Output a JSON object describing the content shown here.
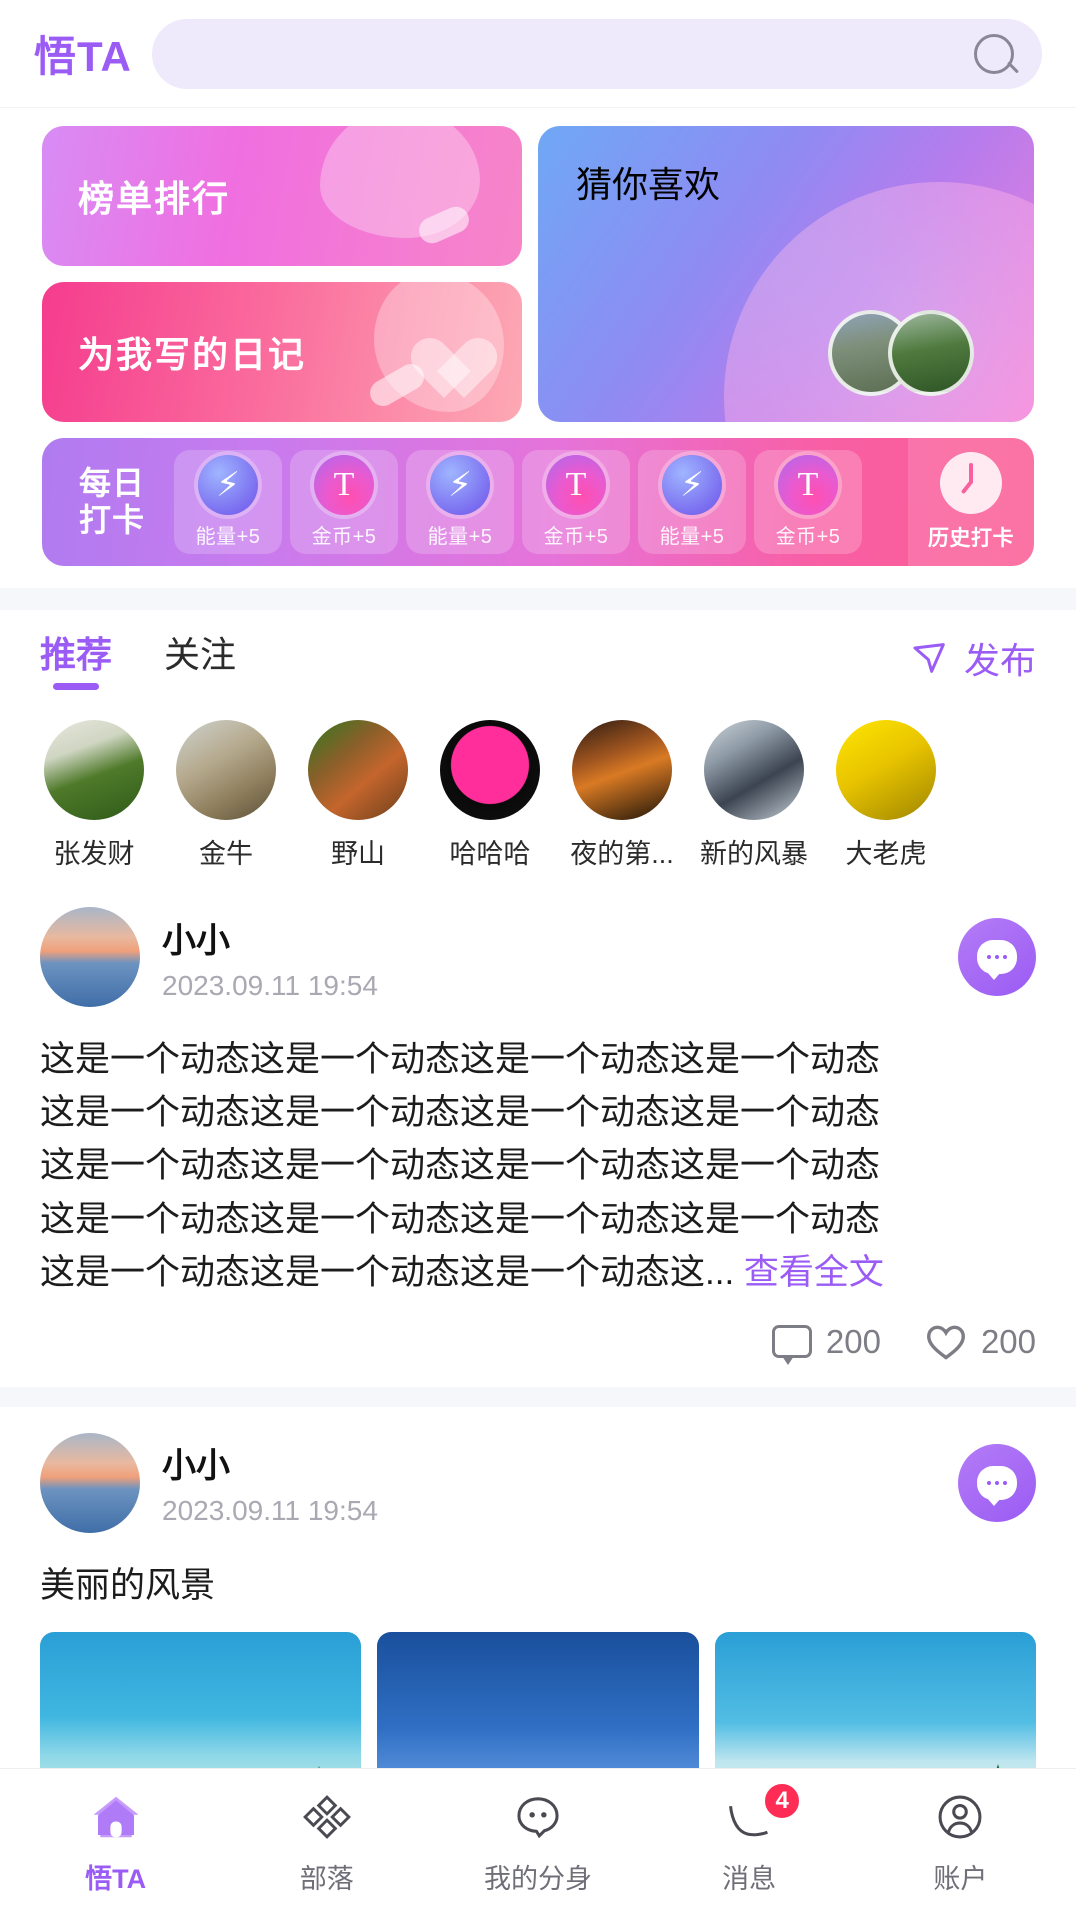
{
  "header": {
    "logo": "悟TA",
    "search_placeholder": "",
    "search_value": "",
    "search_icon": "search-icon"
  },
  "banners": {
    "rank": {
      "title": "榜单排行"
    },
    "diary": {
      "title": "为我写的日记"
    },
    "guess": {
      "title": "猜你喜欢"
    }
  },
  "checkin": {
    "label_line1": "每日",
    "label_line2": "打卡",
    "items": [
      {
        "icon": "energy-icon",
        "label": "能量+5"
      },
      {
        "icon": "coin-icon",
        "label": "金币+5"
      },
      {
        "icon": "energy-icon",
        "label": "能量+5"
      },
      {
        "icon": "coin-icon",
        "label": "金币+5"
      },
      {
        "icon": "energy-icon",
        "label": "能量+5"
      },
      {
        "icon": "coin-icon",
        "label": "金币+5"
      }
    ],
    "history": {
      "icon": "clock-icon",
      "label": "历史打卡"
    }
  },
  "feed_tabs": {
    "tabs": [
      {
        "label": "推荐",
        "active": true
      },
      {
        "label": "关注",
        "active": false
      }
    ],
    "publish": {
      "label": "发布",
      "icon": "send-icon"
    }
  },
  "stories": [
    {
      "name": "张发财"
    },
    {
      "name": "金牛"
    },
    {
      "name": "野山"
    },
    {
      "name": "哈哈哈"
    },
    {
      "name": "夜的第..."
    },
    {
      "name": "新的风暴"
    },
    {
      "name": "大老虎"
    }
  ],
  "posts": [
    {
      "author": "小小",
      "time": "2023.09.11 19:54",
      "more_icon": "comment-more-icon",
      "lines": [
        "这是一个动态这是一个动态这是一个动态这是一个动态",
        "这是一个动态这是一个动态这是一个动态这是一个动态",
        "这是一个动态这是一个动态这是一个动态这是一个动态",
        "这是一个动态这是一个动态这是一个动态这是一个动态",
        "这是一个动态这是一个动态这是一个动态这..."
      ],
      "expand_label": "查看全文",
      "comments": "200",
      "likes": "200"
    },
    {
      "author": "小小",
      "time": "2023.09.11 19:54",
      "more_icon": "comment-more-icon",
      "text": "美丽的风景"
    }
  ],
  "bottom_nav": [
    {
      "label": "悟TA",
      "icon": "home-icon",
      "active": true,
      "badge": ""
    },
    {
      "label": "部落",
      "icon": "tribe-icon",
      "active": false,
      "badge": ""
    },
    {
      "label": "我的分身",
      "icon": "avatar-clone-icon",
      "active": false,
      "badge": ""
    },
    {
      "label": "消息",
      "icon": "message-icon",
      "active": false,
      "badge": "4"
    },
    {
      "label": "账户",
      "icon": "account-icon",
      "active": false,
      "badge": ""
    }
  ],
  "colors": {
    "accent": "#9B5CF6",
    "badge": "#ff2d55",
    "muted": "#a9a9b3"
  }
}
